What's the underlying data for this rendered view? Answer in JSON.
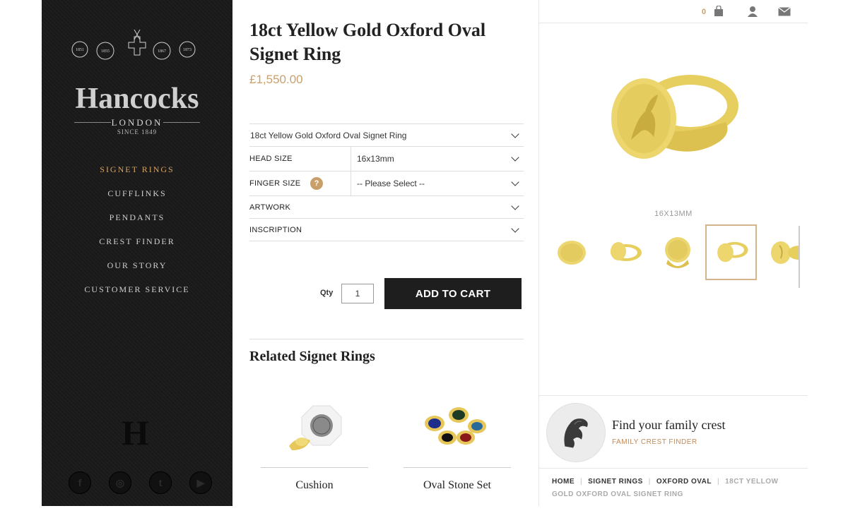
{
  "sidebar": {
    "brand_name": "Hancocks",
    "brand_city": "LONDON",
    "brand_since": "SINCE 1849",
    "nav": [
      "SIGNET RINGS",
      "CUFFLINKS",
      "PENDANTS",
      "CREST FINDER",
      "OUR STORY",
      "CUSTOMER SERVICE"
    ],
    "active_nav": "SIGNET RINGS",
    "monogram": "H",
    "socials": [
      "facebook-icon",
      "instagram-icon",
      "twitter-icon",
      "youtube-icon"
    ]
  },
  "product": {
    "title": "18ct Yellow Gold Oxford Oval Signet Ring",
    "price": "£1,550.00",
    "variant": "18ct Yellow Gold Oxford Oval Signet Ring",
    "head_size_label": "HEAD SIZE",
    "head_size_value": "16x13mm",
    "finger_size_label": "FINGER SIZE",
    "finger_size_help": "?",
    "finger_size_value": "-- Please Select --",
    "artwork_label": "ARTWORK",
    "inscription_label": "INSCRIPTION",
    "qty_label": "Qty",
    "qty_value": "1",
    "add_to_cart": "ADD TO CART"
  },
  "related": {
    "title": "Related Signet Rings",
    "items": [
      {
        "name": "Cushion"
      },
      {
        "name": "Oval Stone Set"
      }
    ]
  },
  "header": {
    "cart_count": "0",
    "icons": [
      "shopping-bag-icon",
      "user-icon",
      "mail-icon"
    ]
  },
  "gallery": {
    "size_caption": "16X13MM",
    "thumbnail_count": 5,
    "selected_thumbnail": 4
  },
  "crest": {
    "title": "Find your family crest",
    "link": "FAMILY CREST FINDER"
  },
  "breadcrumb": [
    "HOME",
    "SIGNET RINGS",
    "OXFORD OVAL",
    "18CT YELLOW GOLD OXFORD OVAL SIGNET RING"
  ],
  "colors": {
    "accent": "#c9a06b",
    "sidebar_bg": "#1b1a1a",
    "button_bg": "#1e1e1e",
    "gold": "#e8d36a"
  }
}
